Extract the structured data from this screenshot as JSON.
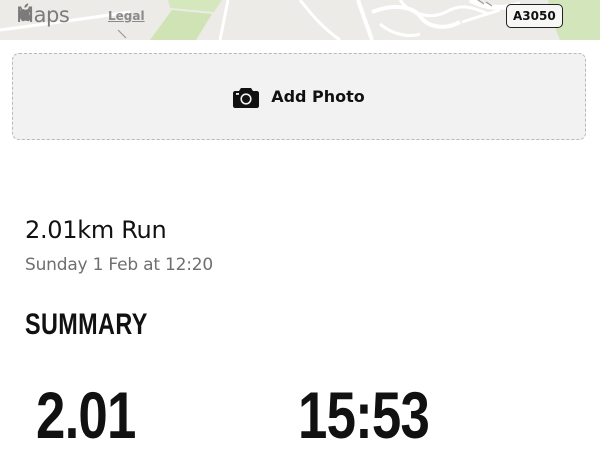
{
  "map": {
    "brand": "Maps",
    "legal_label": "Legal",
    "road_label": "A3050"
  },
  "add_photo": {
    "label": "Add Photo",
    "icon": "camera-icon"
  },
  "activity": {
    "title": "2.01km Run",
    "datetime": "Sunday 1 Feb at 12:20"
  },
  "summary": {
    "heading": "SUMMARY",
    "distance_value": "2.01",
    "time_value": "15:53"
  }
}
